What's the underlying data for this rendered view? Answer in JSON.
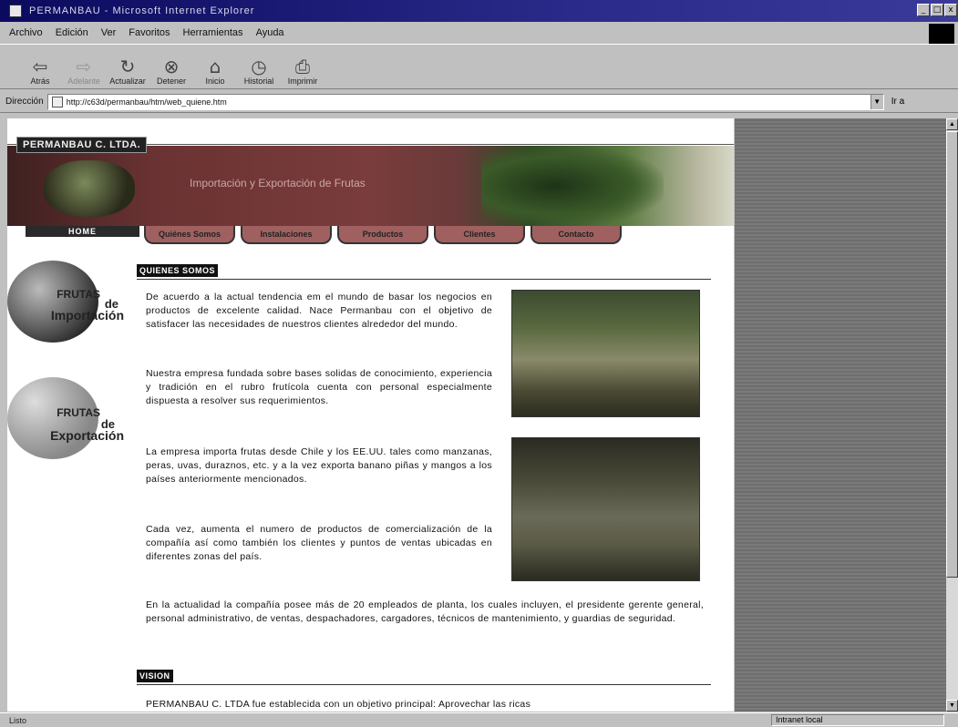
{
  "window": {
    "title": "PERMANBAU - Microsoft Internet Explorer",
    "controls": [
      "_",
      "□",
      "x"
    ]
  },
  "menu": [
    "Archivo",
    "Edición",
    "Ver",
    "Favoritos",
    "Herramientas",
    "Ayuda"
  ],
  "toolbar": [
    {
      "label": "Atrás",
      "icon": "back-arrow-icon",
      "glyph": "⇦"
    },
    {
      "label": "Adelante",
      "icon": "forward-arrow-icon",
      "glyph": "⇨"
    },
    {
      "label": "Actualizar",
      "icon": "refresh-icon",
      "glyph": "↻"
    },
    {
      "label": "Detener",
      "icon": "stop-icon",
      "glyph": "⊗"
    },
    {
      "label": "Inicio",
      "icon": "home-icon",
      "glyph": "⌂"
    },
    {
      "label": "Historial",
      "icon": "history-icon",
      "glyph": "◷"
    },
    {
      "label": "Imprimir",
      "icon": "print-icon",
      "glyph": "⎙"
    }
  ],
  "address": {
    "label": "Dirección",
    "url": "http://c63d/permanbau/htm/web_quiene.htm",
    "go": "Ir a"
  },
  "page": {
    "brand": "PERMANBAU C. LTDA.",
    "tagline": "Importación y Exportación de Frutas",
    "nav": [
      "HOME",
      "Quiénes Somos",
      "Instalaciones",
      "Productos",
      "Clientes",
      "Contacto"
    ],
    "sidebar": {
      "import": {
        "l1": "FRUTAS",
        "l2": "de",
        "l3": "Importación"
      },
      "export": {
        "l1": "FRUTAS",
        "l2": "de",
        "l3": "Exportación"
      }
    },
    "section1_title": "QUIENES SOMOS",
    "p1": "De acuerdo a la actual tendencia em el mundo de basar los negocios en productos de excelente calidad. Nace Permanbau con el objetivo de satisfacer las necesidades de nuestros clientes alrededor del mundo.",
    "p2": "Nuestra empresa fundada sobre bases solidas de conocimiento, experiencia y tradición en el rubro frutícola cuenta con personal especialmente dispuesta a resolver sus requerimientos.",
    "p3": "La empresa importa frutas desde Chile y los EE.UU. tales como manzanas, peras, uvas, duraznos, etc. y a la vez exporta banano piñas y mangos a los países anteriormente mencionados.",
    "p4": "Cada vez, aumenta el numero de productos de comercialización de la compañía así como también los clientes y puntos de ventas ubicadas en diferentes zonas del país.",
    "p5": "En la actualidad la compañía posee más de 20 empleados de planta, los cuales incluyen, el presidente gerente general, personal administrativo, de ventas, despachadores, cargadores, técnicos de mantenimiento, y guardias de seguridad.",
    "section2_title": "VISION",
    "p6": "PERMANBAU C. LTDA fue establecida con un objetivo principal: Aprovechar las ricas"
  },
  "status": {
    "left": "Listo",
    "zone": "Intranet local"
  }
}
